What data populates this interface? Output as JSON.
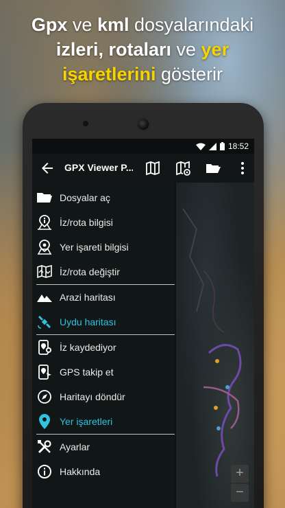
{
  "promo": {
    "line1_a": "Gpx",
    "line1_b": " ve ",
    "line1_c": "kml",
    "line1_d": " dosyalarındaki",
    "line2_a": "izleri, rotaları",
    "line2_b": " ve ",
    "line2_c": "yer",
    "line3_a": "işaretlerini",
    "line3_b": " gösterir"
  },
  "status": {
    "time": "18:52"
  },
  "toolbar": {
    "title": "GPX Viewer P...",
    "icons": [
      "back-arrow-icon",
      "map-icon",
      "map-settings-icon",
      "folder-open-icon",
      "overflow-menu-icon"
    ]
  },
  "menu": {
    "items": [
      {
        "label": "Dosyalar aç",
        "icon": "folder-icon",
        "active": false
      },
      {
        "label": "İz/rota bilgisi",
        "icon": "track-info-icon",
        "active": false
      },
      {
        "label": "Yer işareti bilgisi",
        "icon": "waypoint-info-icon",
        "active": false
      },
      {
        "label": "İz/rota değiştir",
        "icon": "change-track-icon",
        "active": false
      },
      {
        "label": "Arazi haritası",
        "icon": "terrain-icon",
        "active": false
      },
      {
        "label": "Uydu haritası",
        "icon": "satellite-icon",
        "active": true
      },
      {
        "label": "İz kaydediyor",
        "icon": "record-track-icon",
        "active": false
      },
      {
        "label": "GPS takip et",
        "icon": "gps-follow-icon",
        "active": false
      },
      {
        "label": "Haritayı döndür",
        "icon": "compass-icon",
        "active": false
      },
      {
        "label": "Yer işaretleri",
        "icon": "place-marker-icon",
        "active": true
      },
      {
        "label": "Ayarlar",
        "icon": "settings-tools-icon",
        "active": false
      },
      {
        "label": "Hakkında",
        "icon": "info-icon",
        "active": false
      }
    ]
  },
  "colors": {
    "accent": "#2fc3e0",
    "promo_highlight": "#f5d400",
    "drawer_bg": "#121617"
  }
}
